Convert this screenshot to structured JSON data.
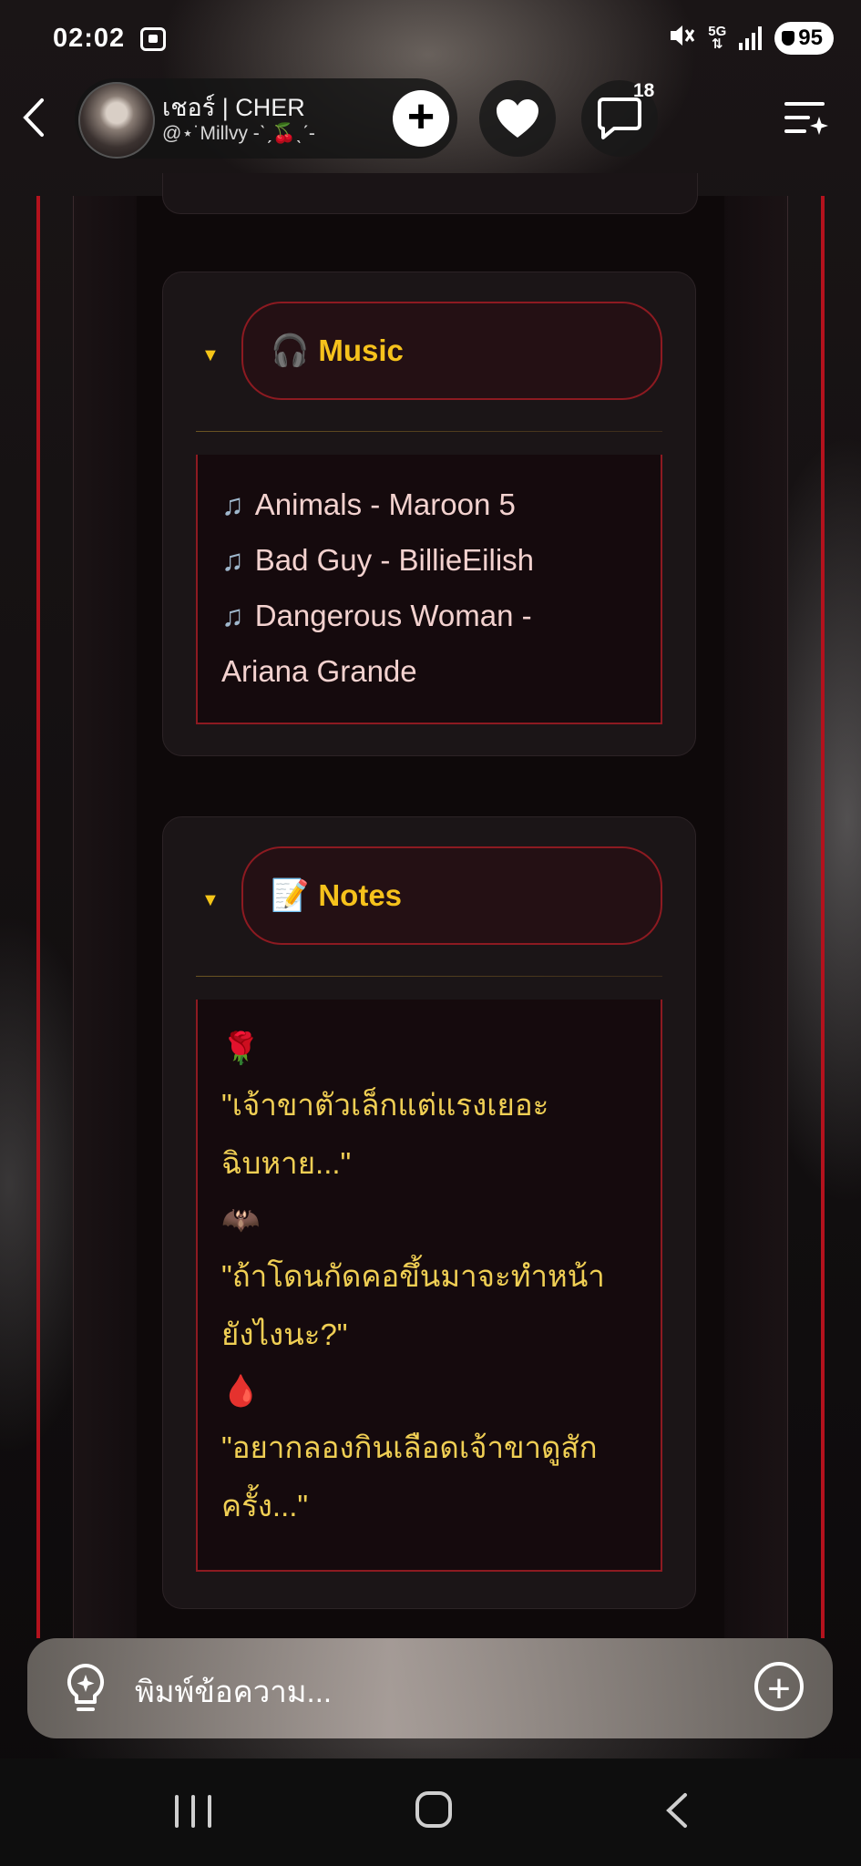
{
  "status_bar": {
    "time": "02:02",
    "network": "5G",
    "battery": "95"
  },
  "header": {
    "character_name": "เชอร์ | CHER",
    "character_handle": "@⋆˙Millvy -ˋˏ🍒ˎˊ-",
    "chat_count": "18"
  },
  "music_section": {
    "title": "Music",
    "icon": "🎧",
    "songs": [
      {
        "text": "Animals - Maroon 5"
      },
      {
        "text": "Bad Guy - BillieEilish"
      },
      {
        "text": "Dangerous Woman -"
      },
      {
        "text": "Ariana Grande"
      }
    ]
  },
  "notes_section": {
    "title": "Notes",
    "icon": "📝",
    "notes": [
      {
        "emoji": "🌹",
        "line1": "\"เจ้าขาตัวเล็กแต่แรงเยอะ",
        "line2": "ฉิบหาย...\""
      },
      {
        "emoji": "🦇",
        "line1": "\"ถ้าโดนกัดคอขึ้นมาจะทำหน้า",
        "line2": "ยังไงนะ?\""
      },
      {
        "emoji": "🩸",
        "line1": "\"อยากลองกินเลือดเจ้าขาดูสัก",
        "line2": "ครั้ง...\""
      }
    ]
  },
  "input": {
    "placeholder": "พิมพ์ข้อความ..."
  },
  "colors": {
    "accent_gold": "#f6c21c",
    "accent_red": "#8d1a21",
    "stripe_red": "#b3121d"
  },
  "icons": [
    "back-icon",
    "plus-icon",
    "heart-icon",
    "chat-bubble-icon",
    "menu-icon",
    "lightbulb-icon",
    "headphones-icon",
    "memo-icon",
    "music-note-icon"
  ]
}
